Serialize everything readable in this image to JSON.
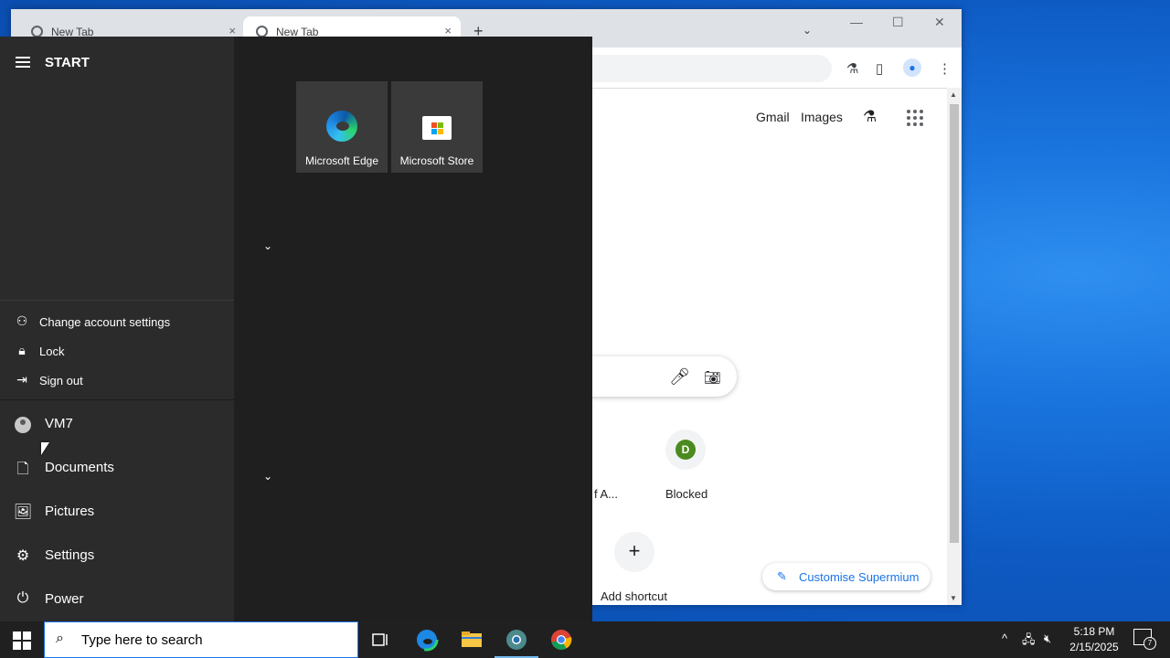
{
  "browser": {
    "tabs": [
      {
        "title": "New Tab",
        "close": "×"
      },
      {
        "title": "New Tab",
        "close": "×"
      }
    ],
    "new_tab_symbol": "+",
    "tab_search_symbol": "⌄",
    "window_controls": {
      "minimize": "—",
      "maximize": "☐",
      "close": "✕"
    },
    "toolbar_icons": {
      "labs": "⚗",
      "side_panel": "▯",
      "profile": "👤",
      "menu": "⋮"
    },
    "ntp": {
      "links": [
        "Gmail",
        "Images"
      ],
      "labs_icon": "⚗",
      "shortcuts": [
        {
          "label": "f A...",
          "letter": ""
        },
        {
          "label": "Blocked",
          "letter": "D"
        }
      ],
      "add_shortcut": {
        "symbol": "+",
        "label": "Add shortcut"
      },
      "customise_label": "Customise Supermium",
      "customise_icon": "✎"
    }
  },
  "start_menu": {
    "title": "START",
    "account_flyout": [
      {
        "label": "Change account settings",
        "icon": "person-gear-icon"
      },
      {
        "label": "Lock",
        "icon": "lock-icon"
      },
      {
        "label": "Sign out",
        "icon": "sign-out-icon"
      }
    ],
    "nav": [
      {
        "label": "VM7",
        "icon": "user-avatar-icon"
      },
      {
        "label": "Documents",
        "icon": "document-icon"
      },
      {
        "label": "Pictures",
        "icon": "pictures-icon"
      },
      {
        "label": "Settings",
        "icon": "gear-icon"
      },
      {
        "label": "Power",
        "icon": "power-icon"
      }
    ],
    "tiles": [
      {
        "label": "Microsoft Edge"
      },
      {
        "label": "Microsoft Store"
      }
    ],
    "chevron": "⌄"
  },
  "taskbar": {
    "search_placeholder": "Type here to search",
    "clock_time": "5:18 PM",
    "clock_date": "2/15/2025",
    "notification_count": "7",
    "tray_chevron": "^"
  }
}
